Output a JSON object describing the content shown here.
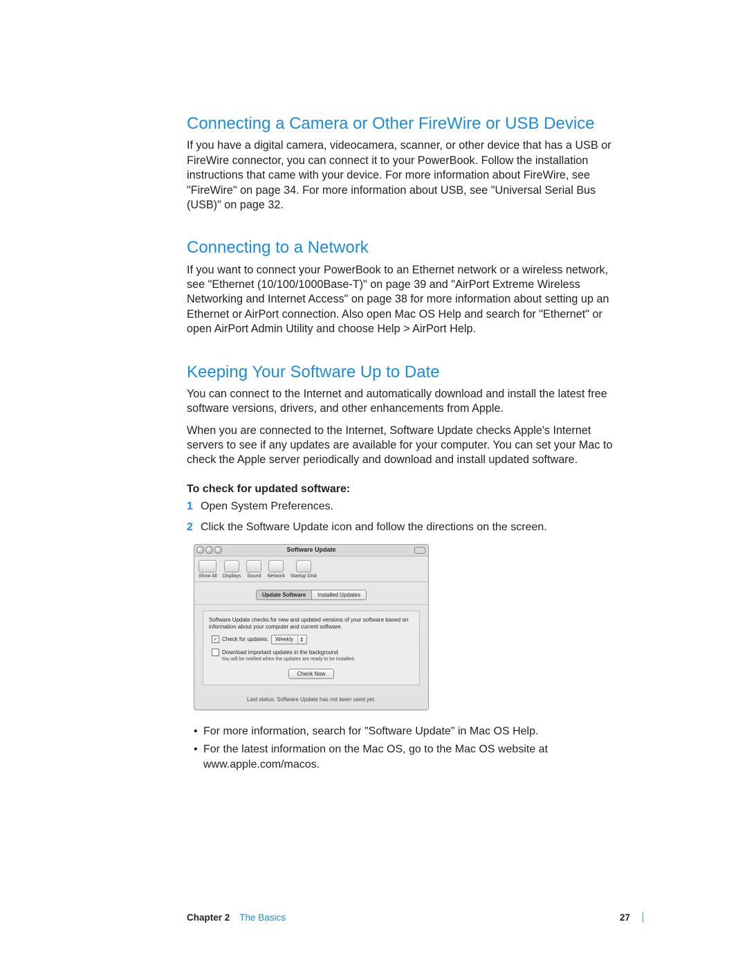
{
  "section1": {
    "heading": "Connecting a Camera or Other FireWire or USB Device",
    "body": "If you have a digital camera, videocamera, scanner, or other device that has a USB or FireWire connector, you can connect it to your PowerBook. Follow the installation instructions that came with your device. For more information about FireWire, see \"FireWire\" on page 34. For more information about USB, see \"Universal Serial Bus (USB)\" on page 32."
  },
  "section2": {
    "heading": "Connecting to a Network",
    "body": "If you want to connect your PowerBook to an Ethernet network or a wireless network, see \"Ethernet (10/100/1000Base-T)\" on page 39 and \"AirPort Extreme Wireless Networking and Internet Access\" on page 38 for more information about setting up an Ethernet or AirPort connection. Also open Mac OS Help and search for \"Ethernet\" or open AirPort Admin Utility and choose Help > AirPort Help."
  },
  "section3": {
    "heading": "Keeping Your Software Up to Date",
    "body1": "You can connect to the Internet and automatically download and install the latest free software versions, drivers, and other enhancements from Apple.",
    "body2": "When you are connected to the Internet, Software Update checks Apple's Internet servers to see if any updates are available for your computer. You can set your Mac to check the Apple server periodically and download and install updated software.",
    "subhead": "To check for updated software:",
    "step1": "Open System Preferences.",
    "step2": "Click the Software Update icon and follow the directions on the screen.",
    "bullet1": "For more information, search for \"Software Update\" in Mac OS Help.",
    "bullet2": "For the latest information on the Mac OS, go to the Mac OS website at www.apple.com/macos."
  },
  "window": {
    "title": "Software Update",
    "toolbar": {
      "showall": "Show All",
      "displays": "Displays",
      "sound": "Sound",
      "network": "Network",
      "startup": "Startup Disk"
    },
    "tabs": {
      "t1": "Update Software",
      "t2": "Installed Updates"
    },
    "desc": "Software Update checks for new and updated versions of your software based on information about your computer and current software.",
    "checkfor_label": "Check for updates:",
    "checkfor_value": "Weekly",
    "dl_label": "Download important updates in the background",
    "dl_sub": "You will be notified when the updates are ready to be installed.",
    "button": "Check Now",
    "status": "Last status: Software Update has not been used yet."
  },
  "footer": {
    "chapter": "Chapter 2",
    "title": "The Basics",
    "page": "27"
  }
}
